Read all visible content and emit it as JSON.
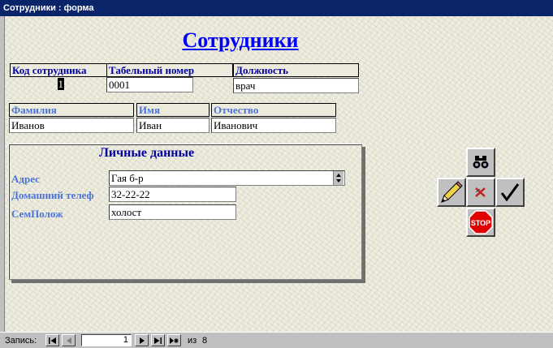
{
  "window": {
    "title": "Сотрудники : форма"
  },
  "form": {
    "title": "Сотрудники",
    "fields": {
      "employee_code": {
        "label": "Код сотрудника",
        "value": "1"
      },
      "personnel_number": {
        "label": "Табельный номер",
        "value": "0001"
      },
      "position": {
        "label": "Должность",
        "value": "врач"
      },
      "last_name": {
        "label": "Фамилия",
        "value": "Иванов"
      },
      "first_name": {
        "label": "Имя",
        "value": "Иван"
      },
      "patronymic": {
        "label": "Отчество",
        "value": "Иванович"
      }
    },
    "personal": {
      "title": "Личные данные",
      "address": {
        "label": "Адрес",
        "value": "Гая б-р"
      },
      "home_phone": {
        "label": "Домашний телеф",
        "value": "32-22-22"
      },
      "marital_status": {
        "label": "СемПолож",
        "value": "холост"
      }
    }
  },
  "buttons": {
    "find": "binoculars-icon",
    "edit": "pencil-icon",
    "undo": "cancel-x-icon",
    "confirm": "checkmark-icon",
    "stop": {
      "icon": "stop-sign-icon",
      "label": "STOP"
    }
  },
  "navigator": {
    "label": "Запись:",
    "current": "1",
    "of_label": "из",
    "total": "8"
  },
  "colors": {
    "titlebar": "#0a246a",
    "label_dark": "#0000a0",
    "label_light": "#4b73d6",
    "title": "#0000ff",
    "stop": "#e00000"
  }
}
